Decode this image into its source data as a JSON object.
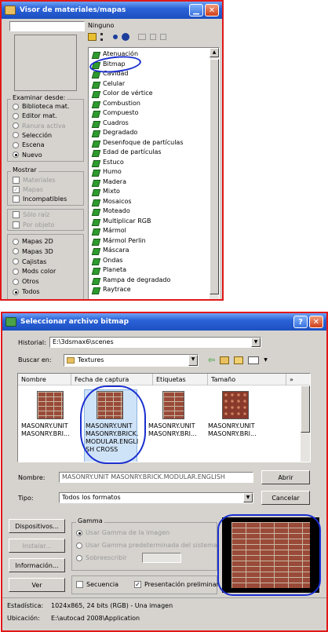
{
  "material_browser": {
    "title": "Visor de materiales/mapas",
    "name_field": "",
    "type_label": "Ninguno",
    "browse_from": {
      "label": "Examinar desde:",
      "options": [
        "Biblioteca mat.",
        "Editor mat.",
        "Ranura activa",
        "Selección",
        "Escena",
        "Nuevo"
      ],
      "selected": "Nuevo"
    },
    "show": {
      "label": "Mostrar",
      "options": [
        "Materiales",
        "Mapas",
        "Incompatibles"
      ],
      "more": [
        "Sólo raíz",
        "Por objeto"
      ]
    },
    "categories": [
      "Mapas 2D",
      "Mapas 3D",
      "Cajistas",
      "Mods color",
      "Otros",
      "Todos"
    ],
    "categories_selected": "Todos",
    "maps": [
      "Atenuación",
      "Bitmap",
      "Cavidad",
      "Celular",
      "Color de vértice",
      "Combustion",
      "Compuesto",
      "Cuadros",
      "Degradado",
      "Desenfoque de partículas",
      "Edad de partículas",
      "Estuco",
      "Humo",
      "Madera",
      "Mixto",
      "Mosaicos",
      "Moteado",
      "Multiplicar RGB",
      "Mármol",
      "Mármol Perlin",
      "Máscara",
      "Ondas",
      "Planeta",
      "Rampa de degradado",
      "Raytrace"
    ]
  },
  "file_dialog": {
    "title": "Seleccionar archivo bitmap",
    "history_label": "Historial:",
    "history_value": "E:\\3dsmax6\\scenes",
    "lookin_label": "Buscar en:",
    "lookin_value": "Textures",
    "columns": [
      "Nombre",
      "Fecha de captura",
      "Etiquetas",
      "Tamaño",
      "»"
    ],
    "files": [
      {
        "name": "MASONRY.UNIT MASONRY.BRI..."
      },
      {
        "name": "MASONRY.UNIT MASONRY.BRICK.MODULAR.ENGLISH CROSS"
      },
      {
        "name": "MASONRY.UNIT MASONRY.BRI..."
      },
      {
        "name": "MASONRY.UNIT MASONRY.BRI..."
      }
    ],
    "filename_label": "Nombre:",
    "filename_value": "MASONRY.UNIT MASONRY.BRICK.MODULAR.ENGLISH",
    "type_label": "Tipo:",
    "type_value": "Todos los formatos",
    "open_button": "Abrir",
    "cancel_button": "Cancelar",
    "devices_button": "Dispositivos...",
    "setup_button": "Instalar...",
    "info_button": "Información...",
    "view_button": "Ver",
    "gamma": {
      "label": "Gamma",
      "options": [
        "Usar Gamma de la imagen",
        "Usar Gamma predeterminada del sistema",
        "Sobreescribir"
      ]
    },
    "sequence_label": "Secuencia",
    "preview_label": "Presentación preliminar",
    "stats_label": "Estadística:",
    "stats_value": "1024x865, 24 bits (RGB) - Una imagen",
    "location_label": "Ubicación:",
    "location_value": "E:\\autocad 2008\\Application"
  }
}
